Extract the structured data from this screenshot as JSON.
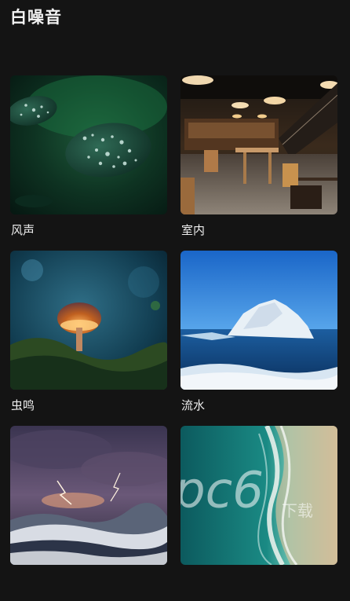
{
  "header": {
    "title": "白噪音"
  },
  "sounds": [
    {
      "label": "风声",
      "scene": "water-droplets-leaf"
    },
    {
      "label": "室内",
      "scene": "restaurant-interior"
    },
    {
      "label": "虫鸣",
      "scene": "glowing-mushroom"
    },
    {
      "label": "流水",
      "scene": "iceberg"
    },
    {
      "label": "",
      "scene": "stormy-sea"
    },
    {
      "label": "",
      "scene": "beach-shore"
    }
  ],
  "colors": {
    "background": "#141414",
    "text": "#f2f2f2"
  }
}
